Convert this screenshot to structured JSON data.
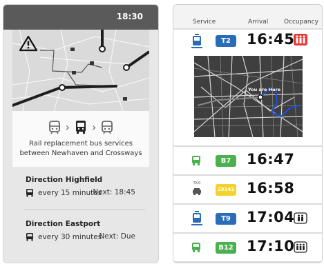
{
  "left": {
    "clock": "18:30",
    "mode_icons": [
      "tram-icon",
      "bus-icon",
      "tram-icon"
    ],
    "message_line1": "Rail replacement bus services",
    "message_line2": "between Newhaven and Crossways",
    "directions": [
      {
        "title": "Direction Highfield",
        "frequency": "every 15 minutes",
        "next": "Next: 18:45"
      },
      {
        "title": "Direction Eastport",
        "frequency": "every 30 minutes",
        "next": "Next: Due"
      }
    ]
  },
  "right": {
    "headers": {
      "service": "Service",
      "arrival": "Arrival",
      "occupancy": "Occupancy"
    },
    "map_label": "You are Here",
    "departures": [
      {
        "type": "tram",
        "route": "T2",
        "badge_color": "#2b6cb8",
        "time": "16:45",
        "occupancy": "high"
      },
      {
        "type": "bus",
        "route": "B7",
        "badge_color": "#4caf50",
        "time": "16:47",
        "occupancy": ""
      },
      {
        "type": "taxi",
        "taxi_label": "TAXI",
        "route": "23142",
        "badge_color": "#f2d22e",
        "time": "16:58",
        "occupancy": ""
      },
      {
        "type": "tram",
        "route": "T9",
        "badge_color": "#2b6cb8",
        "time": "17:04",
        "occupancy": "medium"
      },
      {
        "type": "bus",
        "route": "B12",
        "badge_color": "#4caf50",
        "time": "17:10",
        "occupancy": "medium-high"
      }
    ]
  },
  "colors": {
    "tram": "#2b6cb8",
    "bus": "#4caf50",
    "taxi": "#f2d22e",
    "occupancy_high": "#e53935",
    "header": "#5a5a5a"
  }
}
